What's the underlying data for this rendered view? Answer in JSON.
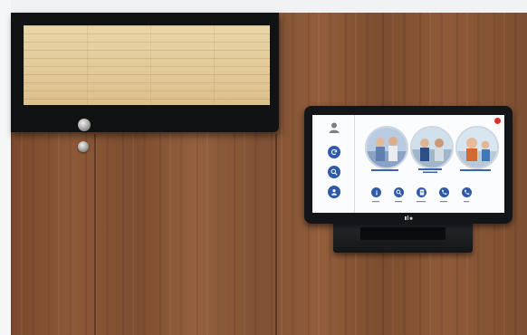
{
  "scene": {
    "description_free": true,
    "tablet": {
      "sidebar": {
        "items": [
          {
            "icon": "person-icon",
            "label": ""
          },
          {
            "icon": "refresh-icon",
            "label": ""
          },
          {
            "icon": "search-icon",
            "label": ""
          },
          {
            "icon": "user-icon",
            "label": ""
          }
        ]
      },
      "cards": [
        {
          "label": "",
          "icon": "people-photo"
        },
        {
          "label": "",
          "icon": "people-photo"
        },
        {
          "label": "",
          "icon": "people-photo"
        }
      ],
      "actions": [
        {
          "icon": "info-icon"
        },
        {
          "icon": "search-icon"
        },
        {
          "icon": "document-icon"
        },
        {
          "icon": "phone-icon"
        },
        {
          "icon": "phone-icon"
        }
      ],
      "logo": "elo-logo"
    },
    "colors": {
      "wood": "#8a5636",
      "bezel": "#141518",
      "accent": "#2f5aa8",
      "close": "#d9342b"
    }
  }
}
